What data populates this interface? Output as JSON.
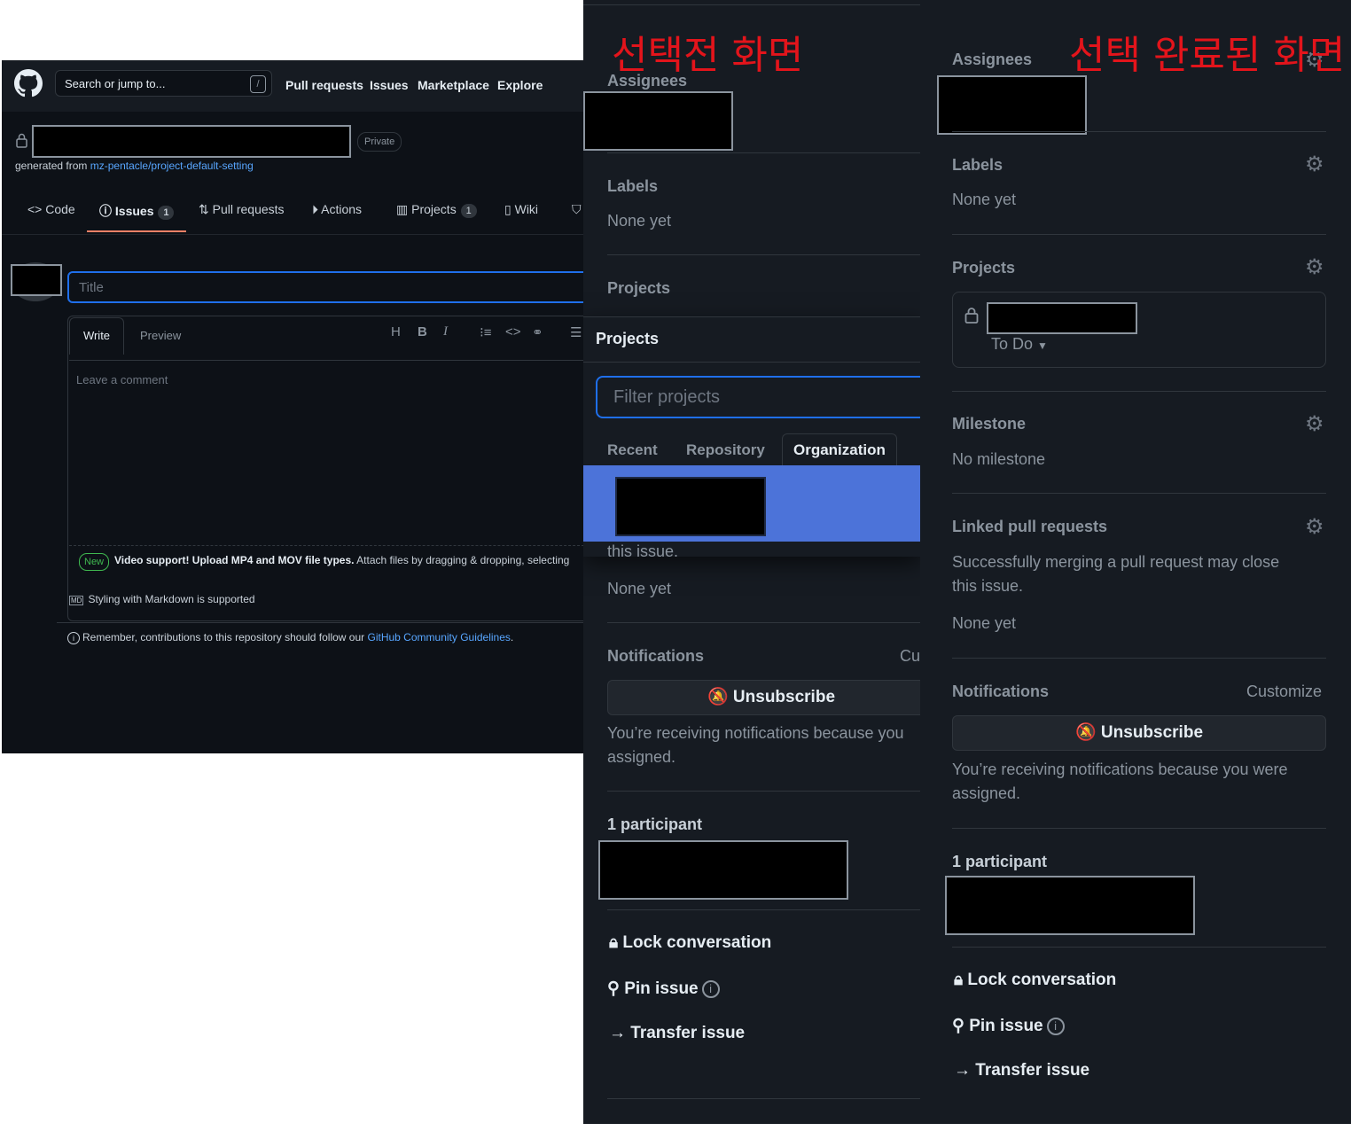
{
  "annotations": {
    "before": "선택전 화면",
    "after": "선택 완료된 화면"
  },
  "main": {
    "header": {
      "search_placeholder": "Search or jump to...",
      "slash_key": "/",
      "nav": [
        "Pull requests",
        "Issues",
        "Marketplace",
        "Explore"
      ]
    },
    "repo": {
      "visibility": "Private",
      "generated_prefix": "generated from",
      "template_link": "mz-pentacle/project-default-setting"
    },
    "tabs": [
      {
        "label": "Code",
        "icon": "code-icon"
      },
      {
        "label": "Issues",
        "icon": "issue-icon",
        "count": "1"
      },
      {
        "label": "Pull requests",
        "icon": "pull-request-icon"
      },
      {
        "label": "Actions",
        "icon": "play-icon"
      },
      {
        "label": "Projects",
        "icon": "project-icon",
        "count": "1"
      },
      {
        "label": "Wiki",
        "icon": "book-icon"
      }
    ],
    "editor": {
      "title_placeholder": "Title",
      "write_tab": "Write",
      "preview_tab": "Preview",
      "toolbar": [
        "H",
        "B",
        "I"
      ],
      "comment_placeholder": "Leave a comment",
      "new_badge": "New",
      "video_bold": "Video support! Upload MP4 and MOV file types.",
      "video_rest": "Attach files by dragging & dropping, selecting",
      "markdown_note": "Styling with Markdown is supported",
      "markdown_badge": "MD"
    },
    "remember_text": "Remember, contributions to this repository should follow our",
    "remember_link": "GitHub Community Guidelines",
    "remember_end": "."
  },
  "before_panel": {
    "assignees": "Assignees",
    "labels": "Labels",
    "labels_value": "None yet",
    "projects": "Projects",
    "overlay": {
      "title": "Projects",
      "filter_placeholder": "Filter projects",
      "tabs": [
        "Recent",
        "Repository",
        "Organization"
      ],
      "active_tab": "Organization"
    },
    "linked_tail": "this issue.",
    "linked_value": "None yet",
    "notifications": "Notifications",
    "customize_cut": "Cu",
    "unsubscribe": "Unsubscribe",
    "notif_text_1": "You’re receiving notifications because you",
    "notif_text_2": "assigned.",
    "participants": "1 participant",
    "lock": "Lock conversation",
    "pin": "Pin issue",
    "transfer": "Transfer issue"
  },
  "after_panel": {
    "assignees": "Assignees",
    "labels": "Labels",
    "labels_value": "None yet",
    "projects": "Projects",
    "project_status": "To Do",
    "milestone": "Milestone",
    "milestone_value": "No milestone",
    "linked": "Linked pull requests",
    "linked_text_1": "Successfully merging a pull request may close",
    "linked_text_2": "this issue.",
    "linked_value": "None yet",
    "notifications": "Notifications",
    "customize": "Customize",
    "unsubscribe": "Unsubscribe",
    "notif_text_1": "You’re receiving notifications because you were",
    "notif_text_2": "assigned.",
    "participants": "1 participant",
    "lock": "Lock conversation",
    "pin": "Pin issue",
    "transfer": "Transfer issue"
  },
  "colors": {
    "accent_blue": "#1f6feb",
    "selected_row": "#4c73d9",
    "annotation_red": "#e3141b",
    "tab_underline": "#f78166"
  }
}
